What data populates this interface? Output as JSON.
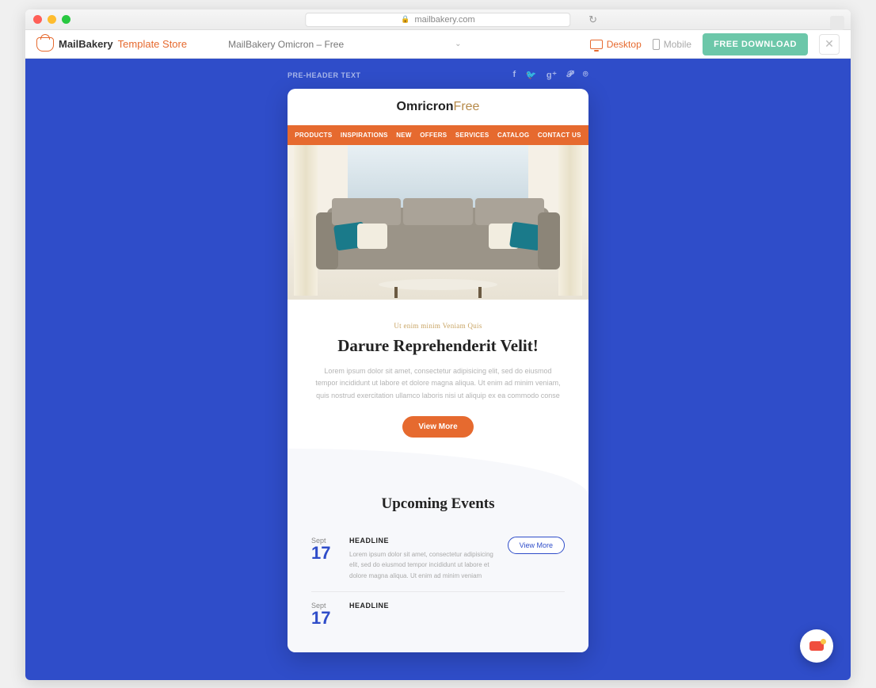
{
  "browser": {
    "url": "mailbakery.com"
  },
  "toolbar": {
    "brand_a": "MailBakery",
    "brand_b": "Template Store",
    "template_name": "MailBakery Omicron – Free",
    "desktop_label": "Desktop",
    "mobile_label": "Mobile",
    "download_label": "FREE DOWNLOAD"
  },
  "preheader": {
    "text": "PRE-HEADER TEXT"
  },
  "email": {
    "brand_a": "Omricron",
    "brand_b": "Free",
    "nav": [
      "PRODUCTS",
      "INSPIRATIONS",
      "NEW",
      "OFFERS",
      "SERVICES",
      "CATALOG",
      "CONTACT US"
    ],
    "eyebrow": "Ut enim minim Veniam Quis",
    "headline": "Darure Reprehenderit Velit!",
    "body": "Lorem ipsum dolor sit amet, consectetur adipisicing elit, sed do eiusmod tempor incididunt ut labore et dolore magna aliqua. Ut enim ad minim veniam, quis nostrud exercitation ullamco laboris nisi ut aliquip ex ea commodo conse",
    "view_more": "View More",
    "events_title": "Upcoming Events",
    "events": [
      {
        "month": "Sept",
        "day": "17",
        "headline": "HEADLINE",
        "text": "Lorem ipsum dolor sit amet, consectetur adipisicing elit, sed do eiusmod tempor incididunt ut labore et dolore magna aliqua. Ut enim ad minim veniam",
        "btn": "View More"
      },
      {
        "month": "Sept",
        "day": "17",
        "headline": "HEADLINE",
        "text": "",
        "btn": ""
      }
    ]
  }
}
